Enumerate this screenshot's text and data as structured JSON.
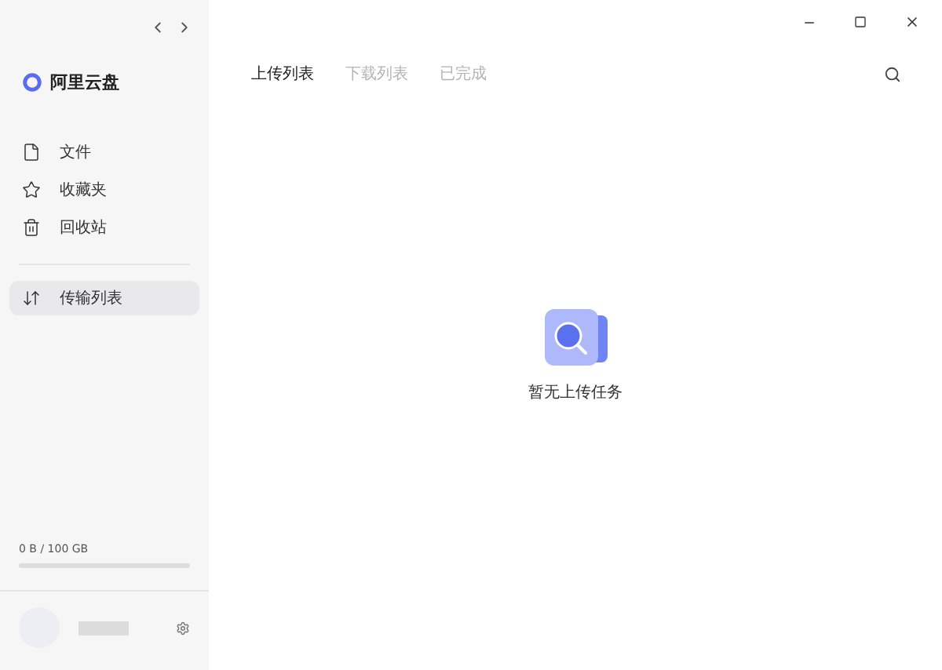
{
  "app": {
    "name": "阿里云盘"
  },
  "sidebar": {
    "items": [
      {
        "kind": "file",
        "label": "文件",
        "selected": false
      },
      {
        "kind": "star",
        "label": "收藏夹",
        "selected": false
      },
      {
        "kind": "trash",
        "label": "回收站",
        "selected": false
      }
    ],
    "transfer": {
      "label": "传输列表",
      "selected": true
    },
    "storage": {
      "text": "0 B / 100 GB",
      "level": 0
    }
  },
  "tabs": [
    {
      "label": "上传列表",
      "selected": true
    },
    {
      "label": "下载列表",
      "selected": false
    },
    {
      "label": "已完成",
      "selected": false
    }
  ],
  "empty_state": {
    "message": "暂无上传任务"
  }
}
